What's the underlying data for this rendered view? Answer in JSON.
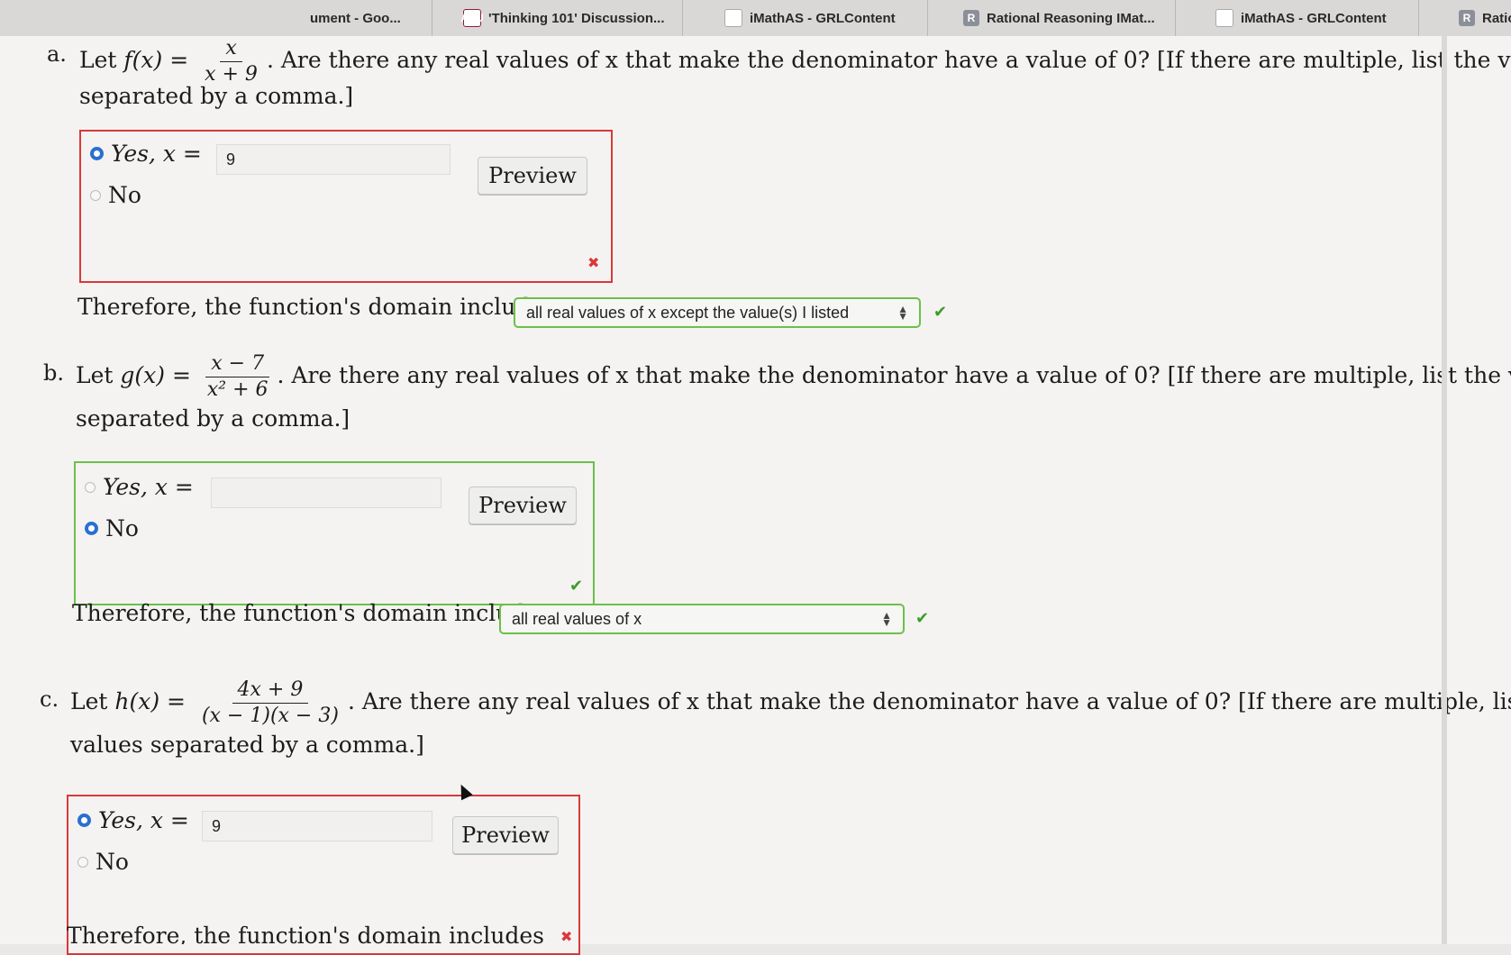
{
  "tabs": [
    {
      "label": "ument - Goo...",
      "icon": "doc-icon"
    },
    {
      "label": "'Thinking 101' Discussion...",
      "icon": "asu-icon"
    },
    {
      "label": "iMathAS - GRLContent",
      "icon": "g-icon"
    },
    {
      "label": "Rational Reasoning IMat...",
      "icon": "r-icon"
    },
    {
      "label": "iMathAS - GRLContent",
      "icon": "g-icon"
    },
    {
      "label": "Ratio",
      "icon": "r-icon"
    }
  ],
  "parts": [
    {
      "letter": "a.",
      "lead": "Let ",
      "fname": "f(x) =",
      "num": "x",
      "den": "x + 9",
      "question": ". Are there any real values of x that make the denominator have a value of 0? [If there are multiple, list the values",
      "question2": "separated by a comma.]",
      "yes_label": "Yes, x =",
      "no_label": "No",
      "selected": "yes",
      "answer": "9",
      "preview_label": "Preview",
      "status": "wrong",
      "domain_text": "Therefore, the function's domain includes",
      "domain_select": "all real values of x except the value(s) I listed",
      "domain_status": "correct"
    },
    {
      "letter": "b.",
      "lead": "Let ",
      "fname": "g(x) =",
      "num": "x − 7",
      "den": "x² + 6",
      "question": ". Are there any real values of x that make the denominator have a value of 0? [If there are multiple, list the values",
      "question2": "separated by a comma.]",
      "yes_label": "Yes, x =",
      "no_label": "No",
      "selected": "no",
      "answer": "",
      "preview_label": "Preview",
      "status": "correct",
      "domain_text": "Therefore, the function's domain includes",
      "domain_select": "all real values of x",
      "domain_status": "correct"
    },
    {
      "letter": "c.",
      "lead": "Let ",
      "fname": "h(x) =",
      "num": "4x + 9",
      "den": "(x − 1)(x − 3)",
      "question": ". Are there any real values of x that make the denominator have a value of 0? [If there are multiple, list the",
      "question2": "values separated by a comma.]",
      "yes_label": "Yes, x =",
      "no_label": "No",
      "selected": "yes",
      "answer": "9",
      "preview_label": "Preview",
      "status": "wrong",
      "domain_text": "Therefore, the function's domain includes"
    }
  ],
  "colors": {
    "wrong": "#d9383a",
    "correct": "#6cc04a",
    "radio_selected": "#2a6fd1"
  }
}
